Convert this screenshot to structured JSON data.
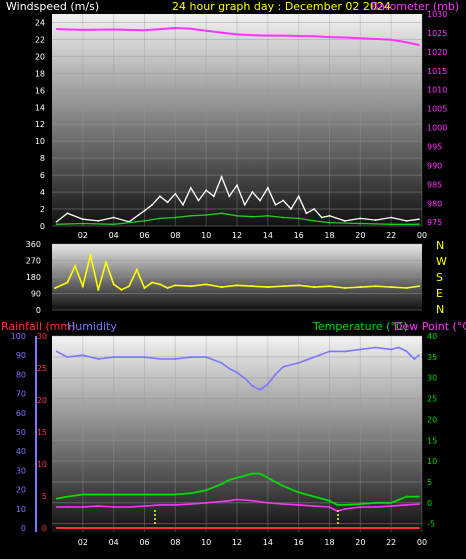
{
  "header": {
    "title": "24 hour graph day : December 02 2024",
    "wind_label": "Windspeed (m/s)",
    "baro_label": "Barometer (mb)"
  },
  "bottom_labels": {
    "rainfall": "Rainfall (mm)",
    "humidity": "Humidity",
    "temperature": "Temperature (°C)",
    "dewpoint": "Dew Point (°C)"
  },
  "colors": {
    "wind": "#ffffff",
    "wind_avg": "#22cc22",
    "barometer": "#ff33ff",
    "wind_dir": "#ffff00",
    "rain": "#ff3333",
    "humidity": "#7777ff",
    "temperature": "#00dd00",
    "dewpoint": "#ff33ff",
    "title": "#ffff00"
  },
  "chart_data": [
    {
      "type": "line",
      "name": "wind_baro",
      "x_ticks": [
        "02",
        "04",
        "06",
        "08",
        "10",
        "12",
        "14",
        "16",
        "18",
        "20",
        "22",
        "00"
      ],
      "xlim": [
        0,
        24
      ],
      "left_axis_ticks": [
        "0",
        "2",
        "4",
        "6",
        "8",
        "10",
        "12",
        "14",
        "16",
        "18",
        "20",
        "22",
        "24"
      ],
      "ylim_left": [
        0,
        25
      ],
      "right_axis_ticks": [
        "975",
        "980",
        "985",
        "990",
        "995",
        "1000",
        "1005",
        "1010",
        "1015",
        "1020",
        "1025",
        "1030"
      ],
      "ylim_right": [
        974,
        1030
      ],
      "series": [
        {
          "key": "barometer",
          "axis": "right",
          "x": [
            0.3,
            2,
            4,
            6,
            7,
            8,
            9,
            10,
            11,
            12,
            13,
            14,
            15,
            16,
            17,
            18,
            19,
            20,
            21,
            22,
            23,
            23.8
          ],
          "y": [
            1026.0,
            1025.8,
            1025.9,
            1025.7,
            1026.0,
            1026.3,
            1026.1,
            1025.6,
            1025.1,
            1024.6,
            1024.4,
            1024.3,
            1024.3,
            1024.2,
            1024.1,
            1023.9,
            1023.8,
            1023.6,
            1023.4,
            1023.2,
            1022.5,
            1021.8
          ]
        },
        {
          "key": "wind_gust",
          "axis": "left",
          "x": [
            0.3,
            1,
            2,
            3,
            4,
            5,
            6,
            6.5,
            7,
            7.5,
            8,
            8.5,
            9,
            9.5,
            10,
            10.5,
            11,
            11.5,
            12,
            12.5,
            13,
            13.5,
            14,
            14.5,
            15,
            15.5,
            16,
            16.5,
            17,
            17.5,
            18,
            19,
            20,
            21,
            22,
            23,
            23.8
          ],
          "y": [
            0.5,
            1.5,
            0.8,
            0.6,
            1.0,
            0.5,
            1.8,
            2.5,
            3.5,
            2.8,
            3.8,
            2.5,
            4.5,
            3.0,
            4.2,
            3.5,
            5.8,
            3.5,
            4.8,
            2.5,
            4.0,
            3.0,
            4.5,
            2.5,
            3.0,
            2.0,
            3.5,
            1.5,
            2.0,
            1.0,
            1.2,
            0.6,
            0.9,
            0.7,
            1.0,
            0.6,
            0.8
          ]
        },
        {
          "key": "wind_avg",
          "axis": "left",
          "x": [
            0.3,
            2,
            4,
            6,
            7,
            8,
            9,
            10,
            11,
            12,
            13,
            14,
            15,
            16,
            17,
            18,
            20,
            22,
            23.8
          ],
          "y": [
            0.2,
            0.3,
            0.2,
            0.6,
            0.9,
            1.0,
            1.2,
            1.3,
            1.5,
            1.2,
            1.1,
            1.2,
            1.0,
            0.9,
            0.6,
            0.4,
            0.3,
            0.2,
            0.2
          ]
        }
      ]
    },
    {
      "type": "line",
      "name": "wind_direction",
      "x_ticks": [],
      "xlim": [
        0,
        24
      ],
      "left_axis_ticks": [
        "0",
        "90",
        "180",
        "270",
        "360"
      ],
      "ylim_left": [
        0,
        360
      ],
      "compass": [
        "N",
        "W",
        "S",
        "E",
        "N"
      ],
      "series": [
        {
          "key": "wind_dir",
          "axis": "left",
          "x": [
            0.2,
            1,
            1.5,
            2,
            2.5,
            3,
            3.5,
            4,
            4.5,
            5,
            5.5,
            6,
            6.5,
            7,
            7.5,
            8,
            9,
            10,
            11,
            12,
            13,
            14,
            15,
            16,
            17,
            18,
            19,
            20,
            21,
            22,
            23,
            23.8
          ],
          "y": [
            120,
            150,
            240,
            130,
            300,
            110,
            260,
            140,
            110,
            130,
            220,
            120,
            150,
            140,
            120,
            135,
            130,
            140,
            125,
            135,
            130,
            125,
            130,
            135,
            125,
            130,
            120,
            125,
            130,
            125,
            120,
            130
          ]
        }
      ]
    },
    {
      "type": "line",
      "name": "rain_humidity_temp",
      "x_ticks": [
        "02",
        "04",
        "06",
        "08",
        "10",
        "12",
        "14",
        "16",
        "18",
        "20",
        "22",
        "00"
      ],
      "xlim": [
        0,
        24
      ],
      "left_outer_ticks": [
        "0",
        "10",
        "20",
        "30",
        "40",
        "50",
        "60",
        "70",
        "80",
        "90",
        "100"
      ],
      "ylim_humidity": [
        0,
        100
      ],
      "left_inner_ticks": [
        "0",
        "5",
        "10",
        "15",
        "20",
        "25",
        "30"
      ],
      "ylim_rain": [
        0,
        30
      ],
      "right_axis_ticks": [
        "-5",
        "0",
        "5",
        "10",
        "15",
        "20",
        "25",
        "30",
        "35",
        "40"
      ],
      "ylim_right": [
        -7,
        40
      ],
      "series": [
        {
          "key": "humidity",
          "axis": "humidity",
          "x": [
            0.3,
            1,
            2,
            3,
            4,
            5,
            6,
            7,
            8,
            9,
            10,
            11,
            11.5,
            12,
            12.5,
            13,
            13.5,
            14,
            14.5,
            15,
            16,
            17,
            18,
            19,
            20,
            21,
            22,
            22.5,
            23,
            23.5,
            23.8
          ],
          "y": [
            92,
            89,
            90,
            88,
            89,
            89,
            89,
            88,
            88,
            89,
            89,
            86,
            83,
            81,
            78,
            74,
            72,
            75,
            80,
            84,
            86,
            89,
            92,
            92,
            93,
            94,
            93,
            94,
            92,
            88,
            90
          ]
        },
        {
          "key": "temperature",
          "axis": "right",
          "x": [
            0.3,
            1,
            2,
            3,
            4,
            5,
            6,
            7,
            8,
            9,
            10,
            11,
            11.5,
            12,
            12.5,
            13,
            13.5,
            14,
            14.5,
            15,
            16,
            17,
            18,
            18.5,
            19,
            20,
            21,
            22,
            23,
            23.8
          ],
          "y": [
            1,
            1.5,
            2,
            2,
            2,
            2,
            2,
            2,
            2,
            2.3,
            3,
            4.5,
            5.5,
            6,
            6.5,
            7,
            7,
            6,
            5,
            4,
            2.5,
            1.5,
            0.5,
            -0.5,
            -0.5,
            -0.3,
            0,
            0,
            1.5,
            1.5
          ]
        },
        {
          "key": "dewpoint",
          "axis": "right",
          "x": [
            0.3,
            1,
            2,
            3,
            4,
            5,
            6,
            7,
            8,
            9,
            10,
            11,
            11.5,
            12,
            13,
            14,
            15,
            16,
            17,
            18,
            18.5,
            19,
            20,
            21,
            22,
            23,
            23.8
          ],
          "y": [
            -1,
            -1,
            -1,
            -0.8,
            -1,
            -1,
            -0.8,
            -0.5,
            -0.5,
            -0.3,
            0,
            0.3,
            0.5,
            0.8,
            0.5,
            0,
            -0.3,
            -0.5,
            -0.8,
            -1,
            -2,
            -1.5,
            -1,
            -1,
            -0.8,
            -0.5,
            -0.3
          ]
        },
        {
          "key": "rain",
          "axis": "rain",
          "x": [
            0.3,
            23.8
          ],
          "y": [
            0,
            0
          ]
        }
      ]
    }
  ]
}
